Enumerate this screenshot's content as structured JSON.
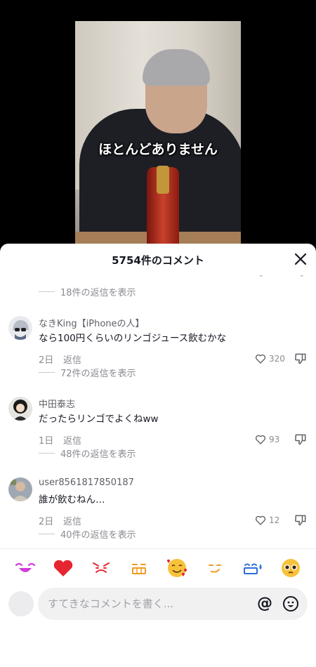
{
  "video": {
    "subtitle": "ほとんどありません"
  },
  "comments_sheet": {
    "title": "5754件のコメント",
    "top_partial": {
      "replies": "18件の返信を表示"
    },
    "comments": [
      {
        "user": "なきKing【iPhoneの人】",
        "text": "なら100円くらいのリンゴジュース飲むかな",
        "age": "2日",
        "reply": "返信",
        "likes": "320",
        "replies": "72件の返信を表示"
      },
      {
        "user": "中田泰志",
        "text": "だったらリンゴでよくねww",
        "age": "1日",
        "reply": "返信",
        "likes": "93",
        "replies": "48件の返信を表示"
      },
      {
        "user": "user8561817850187",
        "text": "誰が飲むねん…",
        "age": "2日",
        "reply": "返信",
        "likes": "12",
        "replies": "40件の返信を表示"
      }
    ],
    "emoji_bar": [
      "laughing",
      "heart",
      "angry",
      "grin",
      "smiling-hearts",
      "smirk",
      "sweat",
      "pleading"
    ],
    "input": {
      "placeholder": "すてきなコメントを書く...",
      "at": "@"
    }
  },
  "colors": {
    "text_primary": "#161823",
    "text_secondary": "#8a8b91",
    "heart": "#fe2c55"
  }
}
